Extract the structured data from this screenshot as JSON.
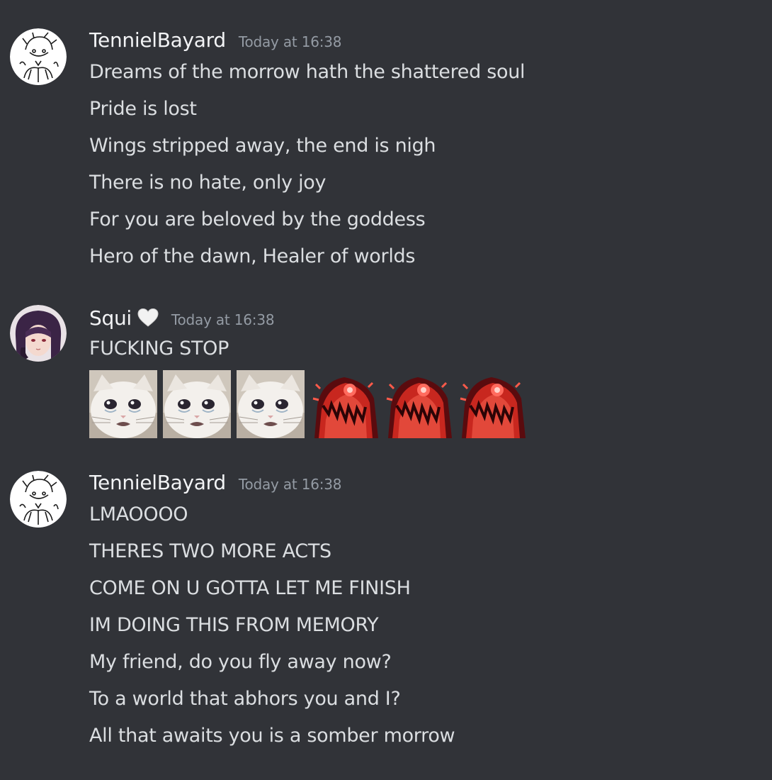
{
  "messages": [
    {
      "author": "TennielBayard",
      "timestamp": "Today at 16:38",
      "lines": [
        "Dreams of the morrow hath the shattered soul",
        "Pride is lost",
        "Wings stripped away, the end is nigh",
        "There is no hate, only joy",
        "For you are beloved by the goddess",
        "Hero of the dawn, Healer of worlds"
      ]
    },
    {
      "author": "Squi",
      "author_badge": "white-heart-icon",
      "timestamp": "Today at 16:38",
      "lines": [
        "FUCKING STOP"
      ],
      "emojis": [
        "crying-cat-emoji",
        "crying-cat-emoji",
        "crying-cat-emoji",
        "angry-red-creature-emoji",
        "angry-red-creature-emoji",
        "angry-red-creature-emoji"
      ]
    },
    {
      "author": "TennielBayard",
      "timestamp": "Today at 16:38",
      "lines": [
        "LMAOOOO",
        "THERES TWO MORE ACTS",
        "COME ON U GOTTA LET ME FINISH",
        "IM DOING THIS FROM MEMORY",
        "My friend, do you fly away now?",
        "To a world that abhors you and I?",
        "All that awaits you is a somber morrow"
      ]
    }
  ],
  "colors": {
    "background": "#313338",
    "username": "#f2f3f5",
    "text": "#dbdee1",
    "timestamp": "#949ba4"
  }
}
